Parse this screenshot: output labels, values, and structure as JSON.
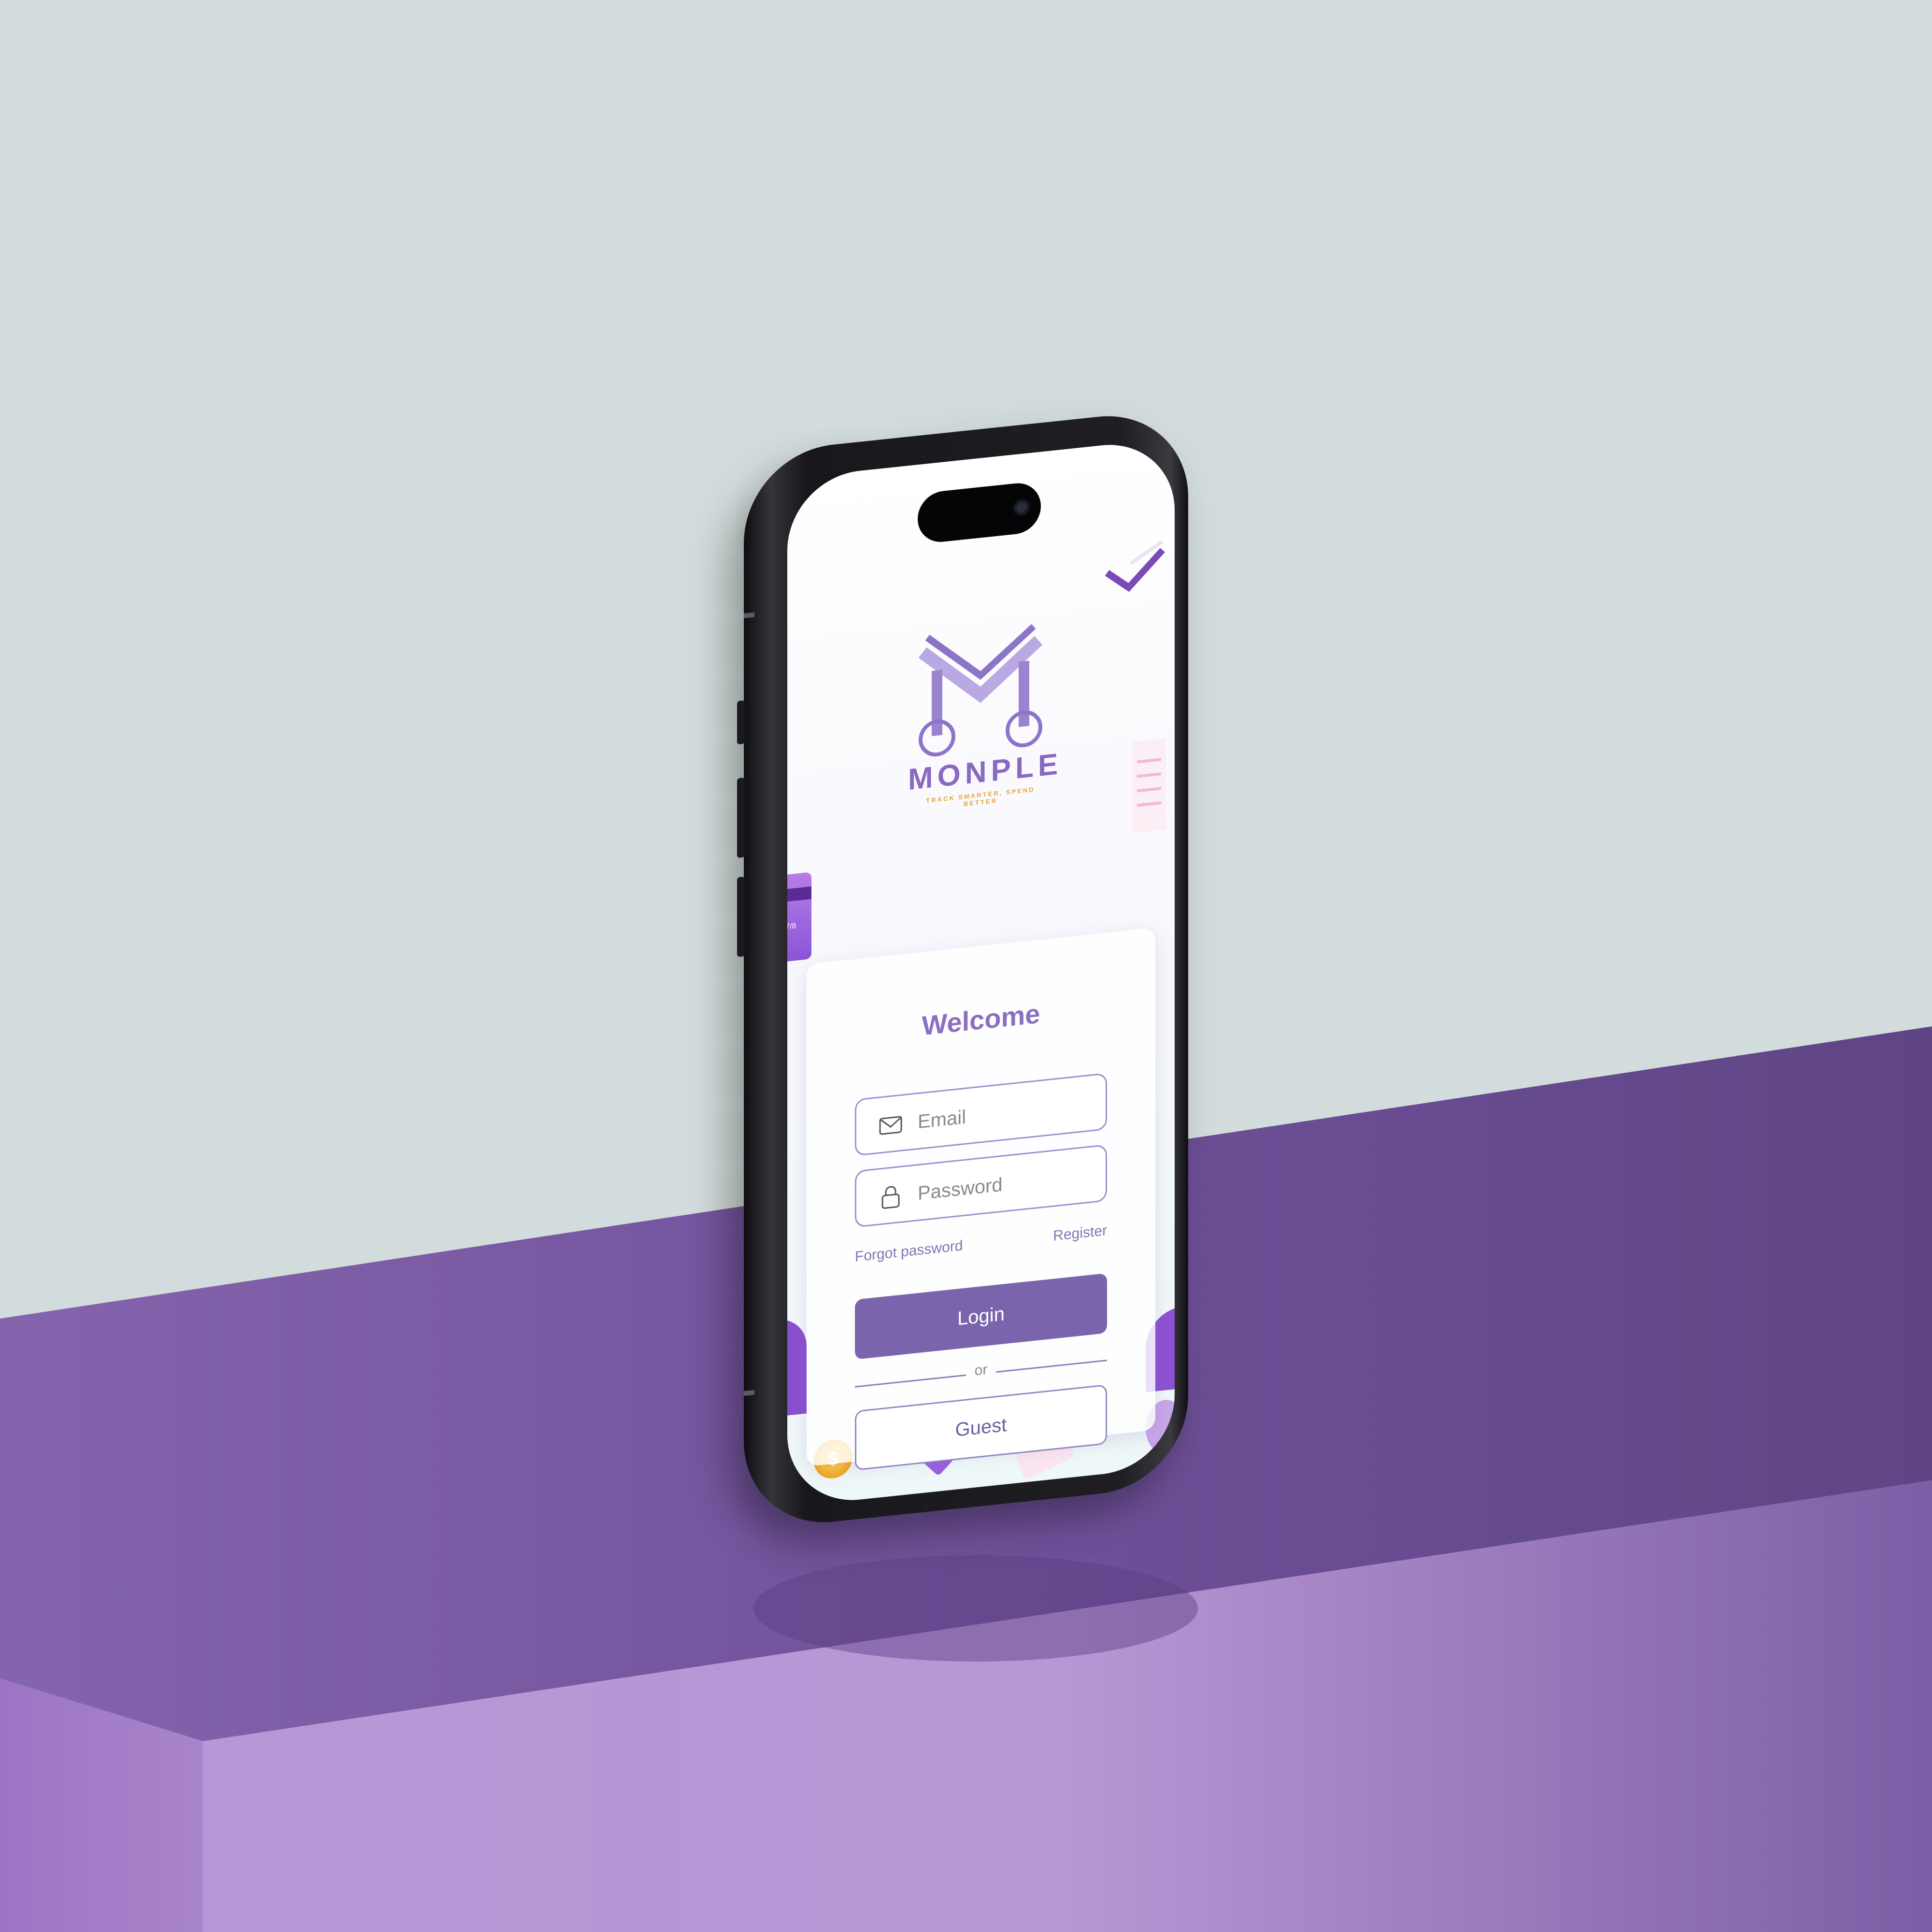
{
  "app": {
    "brand_name": "MONPLE",
    "tagline": "TRACK SMARTER, SPEND BETTER"
  },
  "login": {
    "title": "Welcome",
    "email": {
      "placeholder": "Email",
      "icon": "envelope-icon"
    },
    "password": {
      "placeholder": "Password",
      "icon": "lock-icon"
    },
    "forgot_label": "Forgot password",
    "register_label": "Register",
    "login_label": "Login",
    "divider_label": "or",
    "guest_label": "Guest"
  },
  "decor": {
    "card_number": "7/8",
    "coin_symbol": "$"
  },
  "colors": {
    "accent": "#7a65ad",
    "title": "#8a6fc3",
    "brand": "#8a69c1",
    "tagline": "#e3a63a",
    "backdrop_wall": "#d3dcdc",
    "pedestal": "#7b58a3"
  }
}
